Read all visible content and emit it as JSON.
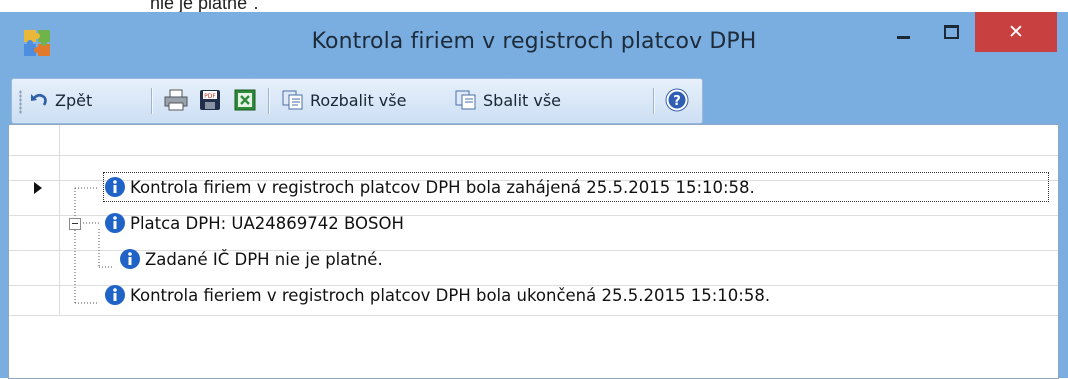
{
  "top_fragment": "nie je platné\".",
  "window": {
    "title": "Kontrola firiem v registroch platcov DPH",
    "close_glyph": "✕"
  },
  "toolbar": {
    "back_label": "Zpět",
    "expand_label": "Rozbalit vše",
    "collapse_label": "Sbalit vše",
    "icons": [
      "back-icon",
      "print-icon",
      "pdf-save-icon",
      "excel-icon",
      "expand-all-icon",
      "collapse-all-icon",
      "help-icon"
    ]
  },
  "tree": {
    "nodes": [
      {
        "text": "Kontrola firiem v registroch platcov DPH bola zahájená 25.5.2015 15:10:58.",
        "level": 0,
        "selected": true
      },
      {
        "text": "Platca DPH: UA24869742 BOSOH",
        "level": 0,
        "expanded": true
      },
      {
        "text": "Zadané IČ DPH nie je platné.",
        "level": 1
      },
      {
        "text": "Kontrola fieriem v registroch platcov DPH bola ukončená 25.5.2015 15:10:58.",
        "level": 0
      }
    ]
  },
  "colors": {
    "window_frame": "#7aaee0",
    "close_button": "#c94040",
    "info_icon": "#1f63c6"
  }
}
